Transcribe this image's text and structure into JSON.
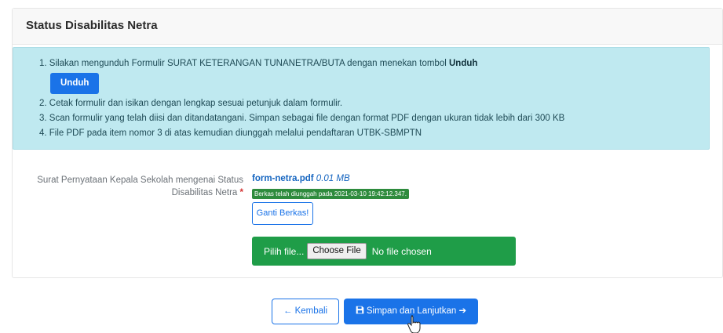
{
  "card": {
    "title": "Status Disabilitas Netra"
  },
  "instructions": {
    "item1_text": "1. Silakan mengunduh Formulir SURAT KETERANGAN TUNANETRA/BUTA dengan menekan tombol ",
    "item1_bold": "Unduh",
    "unduh_button": "Unduh",
    "item2": "2. Cetak formulir dan isikan dengan lengkap sesuai petunjuk dalam formulir.",
    "item3": "3. Scan formulir yang telah diisi dan ditandatangani. Simpan sebagai file dengan format PDF dengan ukuran tidak lebih dari 300 KB",
    "item4": "4. File PDF pada item nomor 3 di atas kemudian diunggah melalui pendaftaran UTBK-SBMPTN"
  },
  "field": {
    "label_line1": "Surat Pernyataan Kepala Sekolah mengenai Status",
    "label_line2": "Disabilitas Netra",
    "required_mark": "*",
    "file_name": "form-netra.pdf",
    "file_size": "0.01 MB",
    "upload_status": "Berkas telah diunggah pada 2021-03-10 19:42:12.347.",
    "change_button": "Ganti Berkas!",
    "pick_file_label": "Pilih file...",
    "choose_file_button": "Choose File",
    "no_file_text": "No file chosen"
  },
  "actions": {
    "back_label": "← Kembali",
    "save_label": "Simpan dan Lanjutkan",
    "save_arrow": "➔"
  },
  "colors": {
    "primary": "#1a73e8",
    "success": "#1f9d48",
    "info_bg": "#bfe9f0",
    "required": "#d32f2f"
  },
  "icons": {
    "save": "floppy-disk-icon",
    "cursor": "hand-pointer-cursor"
  }
}
